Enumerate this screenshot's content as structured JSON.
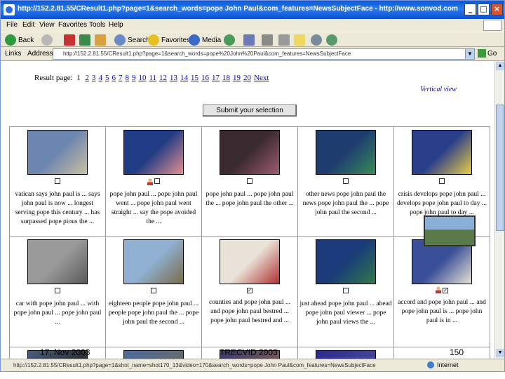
{
  "window": {
    "title": "http://152.2.81.55/CResult1.php?page=1&search_words=pope John Paul&com_features=NewsSubjectFace - http://www.sonvod.com",
    "minimize": "_",
    "maximize": "□",
    "close": "×"
  },
  "menu": [
    "File",
    "Edit",
    "View",
    "Favorites",
    "Tools",
    "Help"
  ],
  "toolbar": {
    "back": "Back",
    "search": "Search",
    "favorites": "Favorites",
    "media": "Media"
  },
  "address": {
    "links_label": "Links",
    "label": "Address",
    "url": "http://152.2.81.55/CResult1.php?page=1&search_words=pope%20John%20Paul&com_features=NewsSubjectFace",
    "go": "Go"
  },
  "pager": {
    "label": "Result page:",
    "pages": [
      "1",
      "2",
      "3",
      "4",
      "5",
      "6",
      "7",
      "8",
      "9",
      "10",
      "11",
      "12",
      "13",
      "14",
      "15",
      "16",
      "17",
      "18",
      "19",
      "20"
    ],
    "next": "Next"
  },
  "vertical_view": "Vertical view",
  "submit_label": "Submit your selection",
  "results": [
    {
      "caption": "vatican says john paul is ... says john paul is now ... longest serving pope this century ... has surpassed pope pious the ...",
      "checked": false,
      "relevant": false,
      "colors": [
        "#6d86b0",
        "#c9c0a2"
      ]
    },
    {
      "caption": "pope john paul ... pope john paul went ... pope john paul went straight ... say the pope avoided the ...",
      "checked": false,
      "relevant": true,
      "colors": [
        "#203c86",
        "#e58f8f"
      ]
    },
    {
      "caption": "pope john paul ... pope john paul the ... pope john paul the other ...",
      "checked": false,
      "relevant": false,
      "colors": [
        "#3b2a30",
        "#9c5c70"
      ]
    },
    {
      "caption": "other news pope john paul the news pope john paul the ... pope john paul the second ...",
      "checked": false,
      "relevant": false,
      "colors": [
        "#1e3c6e",
        "#3b8a5b"
      ]
    },
    {
      "caption": "crisis develops pope john paul ... develops pope john paul to day ... pope john paul to day ...",
      "checked": false,
      "relevant": false,
      "colors": [
        "#2a3f8a",
        "#e8d046"
      ]
    },
    {
      "caption": "car with pope john paul ... with pope john paul ... pope john paul ...",
      "checked": false,
      "relevant": false,
      "colors": [
        "#9a9a9a",
        "#5a5a5a"
      ]
    },
    {
      "caption": "eighteen people pope john paul ... people pope john paul the ... pope john paul the second ...",
      "checked": false,
      "relevant": false,
      "colors": [
        "#8fb0d0",
        "#7b6a4a"
      ]
    },
    {
      "caption": "counties and pope john paul ... and pope john paul bestred ... pope john paul bestred and ...",
      "checked": true,
      "relevant": false,
      "colors": [
        "#e8e2d8",
        "#b03030"
      ]
    },
    {
      "caption": "just ahead pope john paul ... ahead pope john paul viewer ... pope john paul views the ...",
      "checked": false,
      "relevant": false,
      "colors": [
        "#1a3a7a",
        "#2f7a4a"
      ]
    },
    {
      "caption": "accord and pope john paul ... and pope john paul is ... pope john paul is in ...",
      "checked": true,
      "relevant": true,
      "colors": [
        "#3a4f9a",
        "#e6e2d2"
      ]
    }
  ],
  "row3_colors": [
    [
      "#4a5a7a",
      "#2a2a2a"
    ],
    [
      "#4a6a9a",
      "#6a6a6a"
    ],
    [
      "#3a3a6a",
      "#7a5a5a"
    ],
    [
      "#2a2a8a",
      "#4a4a9a"
    ],
    [
      "#ffffff",
      "#ffffff"
    ]
  ],
  "footer": {
    "date": "17, Nov 2003",
    "center": "TRECVID 2003",
    "page": "150"
  },
  "status": {
    "text": "http://152.2.81.55/CResult1.php?page=1&shot_name=shot170_13&video=170&search_words=pope John Paul&com_features=NewsSubjectFace",
    "zone": "Internet"
  }
}
